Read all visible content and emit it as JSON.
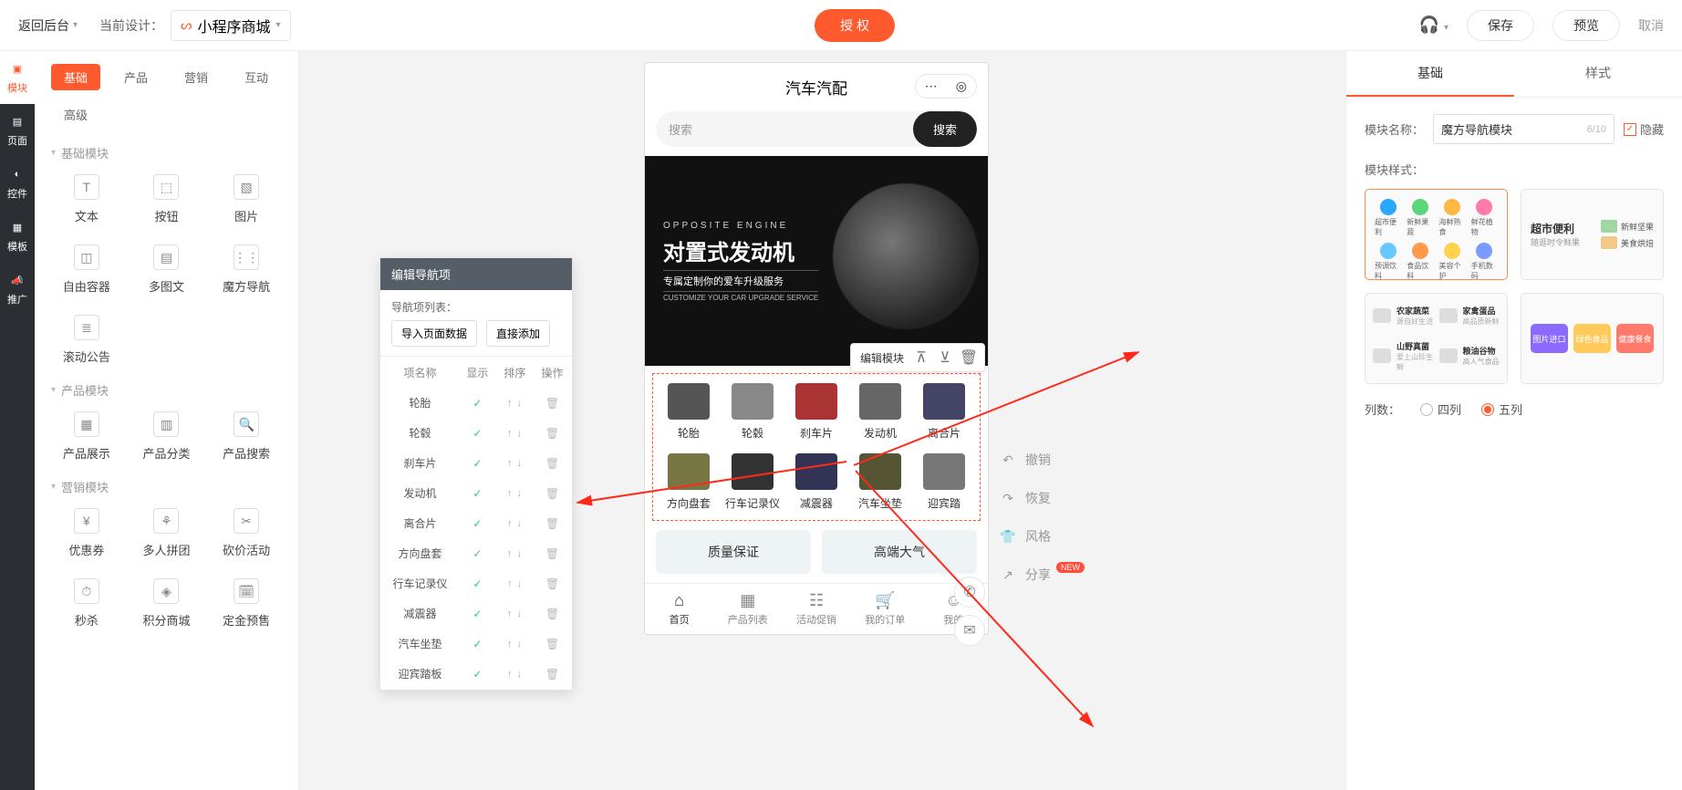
{
  "topbar": {
    "back": "返回后台",
    "current_design_label": "当前设计：",
    "design_name": "小程序商城",
    "auth": "授 权",
    "save": "保存",
    "preview": "预览",
    "cancel": "取消"
  },
  "leftrail": [
    {
      "key": "module",
      "label": "模块"
    },
    {
      "key": "page",
      "label": "页面"
    },
    {
      "key": "control",
      "label": "控件"
    },
    {
      "key": "template",
      "label": "模板"
    },
    {
      "key": "promote",
      "label": "推广"
    }
  ],
  "moduleTabs": [
    "基础",
    "产品",
    "营销",
    "互动",
    "高级"
  ],
  "moduleTabActive": "基础",
  "categories": [
    {
      "title": "基础模块",
      "widgets": [
        {
          "name": "文本",
          "icon": "T"
        },
        {
          "name": "按钮",
          "icon": "⬚"
        },
        {
          "name": "图片",
          "icon": "▧"
        },
        {
          "name": "自由容器",
          "icon": "◫"
        },
        {
          "name": "多图文",
          "icon": "▤"
        },
        {
          "name": "魔方导航",
          "icon": "⋮⋮"
        },
        {
          "name": "滚动公告",
          "icon": "≣"
        }
      ]
    },
    {
      "title": "产品模块",
      "widgets": [
        {
          "name": "产品展示",
          "icon": "▦"
        },
        {
          "name": "产品分类",
          "icon": "▥"
        },
        {
          "name": "产品搜索",
          "icon": "🔍"
        }
      ]
    },
    {
      "title": "营销模块",
      "widgets": [
        {
          "name": "优惠券",
          "icon": "¥"
        },
        {
          "name": "多人拼团",
          "icon": "⚘"
        },
        {
          "name": "砍价活动",
          "icon": "✂"
        },
        {
          "name": "秒杀",
          "icon": "⏱"
        },
        {
          "name": "积分商城",
          "icon": "◈"
        },
        {
          "name": "定金预售",
          "icon": "🗓"
        }
      ]
    }
  ],
  "phone": {
    "title": "汽车汽配",
    "search_placeholder": "搜索",
    "search_btn": "搜索",
    "banner": {
      "eng": "OPPOSITE ENGINE",
      "zh": "对置式发动机",
      "sub": "专属定制你的爱车升级服务",
      "sub2": "CUSTOMIZE YOUR CAR UPGRADE SERVICE"
    },
    "edit_toolbar": "编辑模块",
    "nav_items": [
      "轮胎",
      "轮毂",
      "刹车片",
      "发动机",
      "离合片",
      "方向盘套",
      "行车记录仪",
      "减震器",
      "汽车坐垫",
      "迎宾踏"
    ],
    "quality": [
      "质量保证",
      "高端大气"
    ],
    "tabbar": [
      {
        "label": "首页",
        "icon": "⌂"
      },
      {
        "label": "产品列表",
        "icon": "▦"
      },
      {
        "label": "活动促销",
        "icon": "☷"
      },
      {
        "label": "我的订单",
        "icon": "🛒"
      },
      {
        "label": "我的",
        "icon": "☺"
      }
    ]
  },
  "floatActions": [
    {
      "label": "撤销",
      "icon": "↶"
    },
    {
      "label": "恢复",
      "icon": "↷"
    },
    {
      "label": "风格",
      "icon": "👕"
    },
    {
      "label": "分享",
      "icon": "↗",
      "badge": "NEW"
    }
  ],
  "navPopup": {
    "title": "编辑导航项",
    "section": "导航项列表：",
    "btn_import": "导入页面数据",
    "btn_add": "直接添加",
    "columns": [
      "项名称",
      "显示",
      "排序",
      "操作"
    ],
    "rows": [
      "轮胎",
      "轮毂",
      "刹车片",
      "发动机",
      "离合片",
      "方向盘套",
      "行车记录仪",
      "减震器",
      "汽车坐垫",
      "迎宾踏板"
    ]
  },
  "inspector": {
    "tab_basic": "基础",
    "tab_style": "样式",
    "name_label": "模块名称：",
    "name_value": "魔方导航模块",
    "name_count": "6/10",
    "hide_label": "隐藏",
    "style_label": "模块样式：",
    "miniIcons": [
      {
        "label": "超市便利",
        "color": "#2aa7ff"
      },
      {
        "label": "新鲜果蔬",
        "color": "#5bd67a"
      },
      {
        "label": "海鲜熟食",
        "color": "#ffb843"
      },
      {
        "label": "鲜花植物",
        "color": "#ff7aa8"
      },
      {
        "label": "预调饮料",
        "color": "#67c8ff"
      },
      {
        "label": "食品饮料",
        "color": "#ff9a4d"
      },
      {
        "label": "美容个护",
        "color": "#ffd24d"
      },
      {
        "label": "手机数码",
        "color": "#7a9bff"
      }
    ],
    "style2": {
      "title": "超市便利",
      "sub": "随逛时令鲜果",
      "r1": "新鲜坚果",
      "r2": "美食烘焙"
    },
    "style3": [
      {
        "t": "农家蔬菜",
        "s": "源自好生活"
      },
      {
        "t": "家禽蛋品",
        "s": "高品质新鲜"
      },
      {
        "t": "山野真菌",
        "s": "爱上山珍生鲜"
      },
      {
        "t": "粮油谷物",
        "s": "高人气食品"
      }
    ],
    "style4": [
      {
        "label": "图片进口",
        "color": "#8a6aff"
      },
      {
        "label": "绿色食品",
        "color": "#ffca5a"
      },
      {
        "label": "健康餐食",
        "color": "#ff7a6a"
      }
    ],
    "cols_label": "列数：",
    "cols_options": [
      "四列",
      "五列"
    ],
    "cols_selected": "五列"
  }
}
